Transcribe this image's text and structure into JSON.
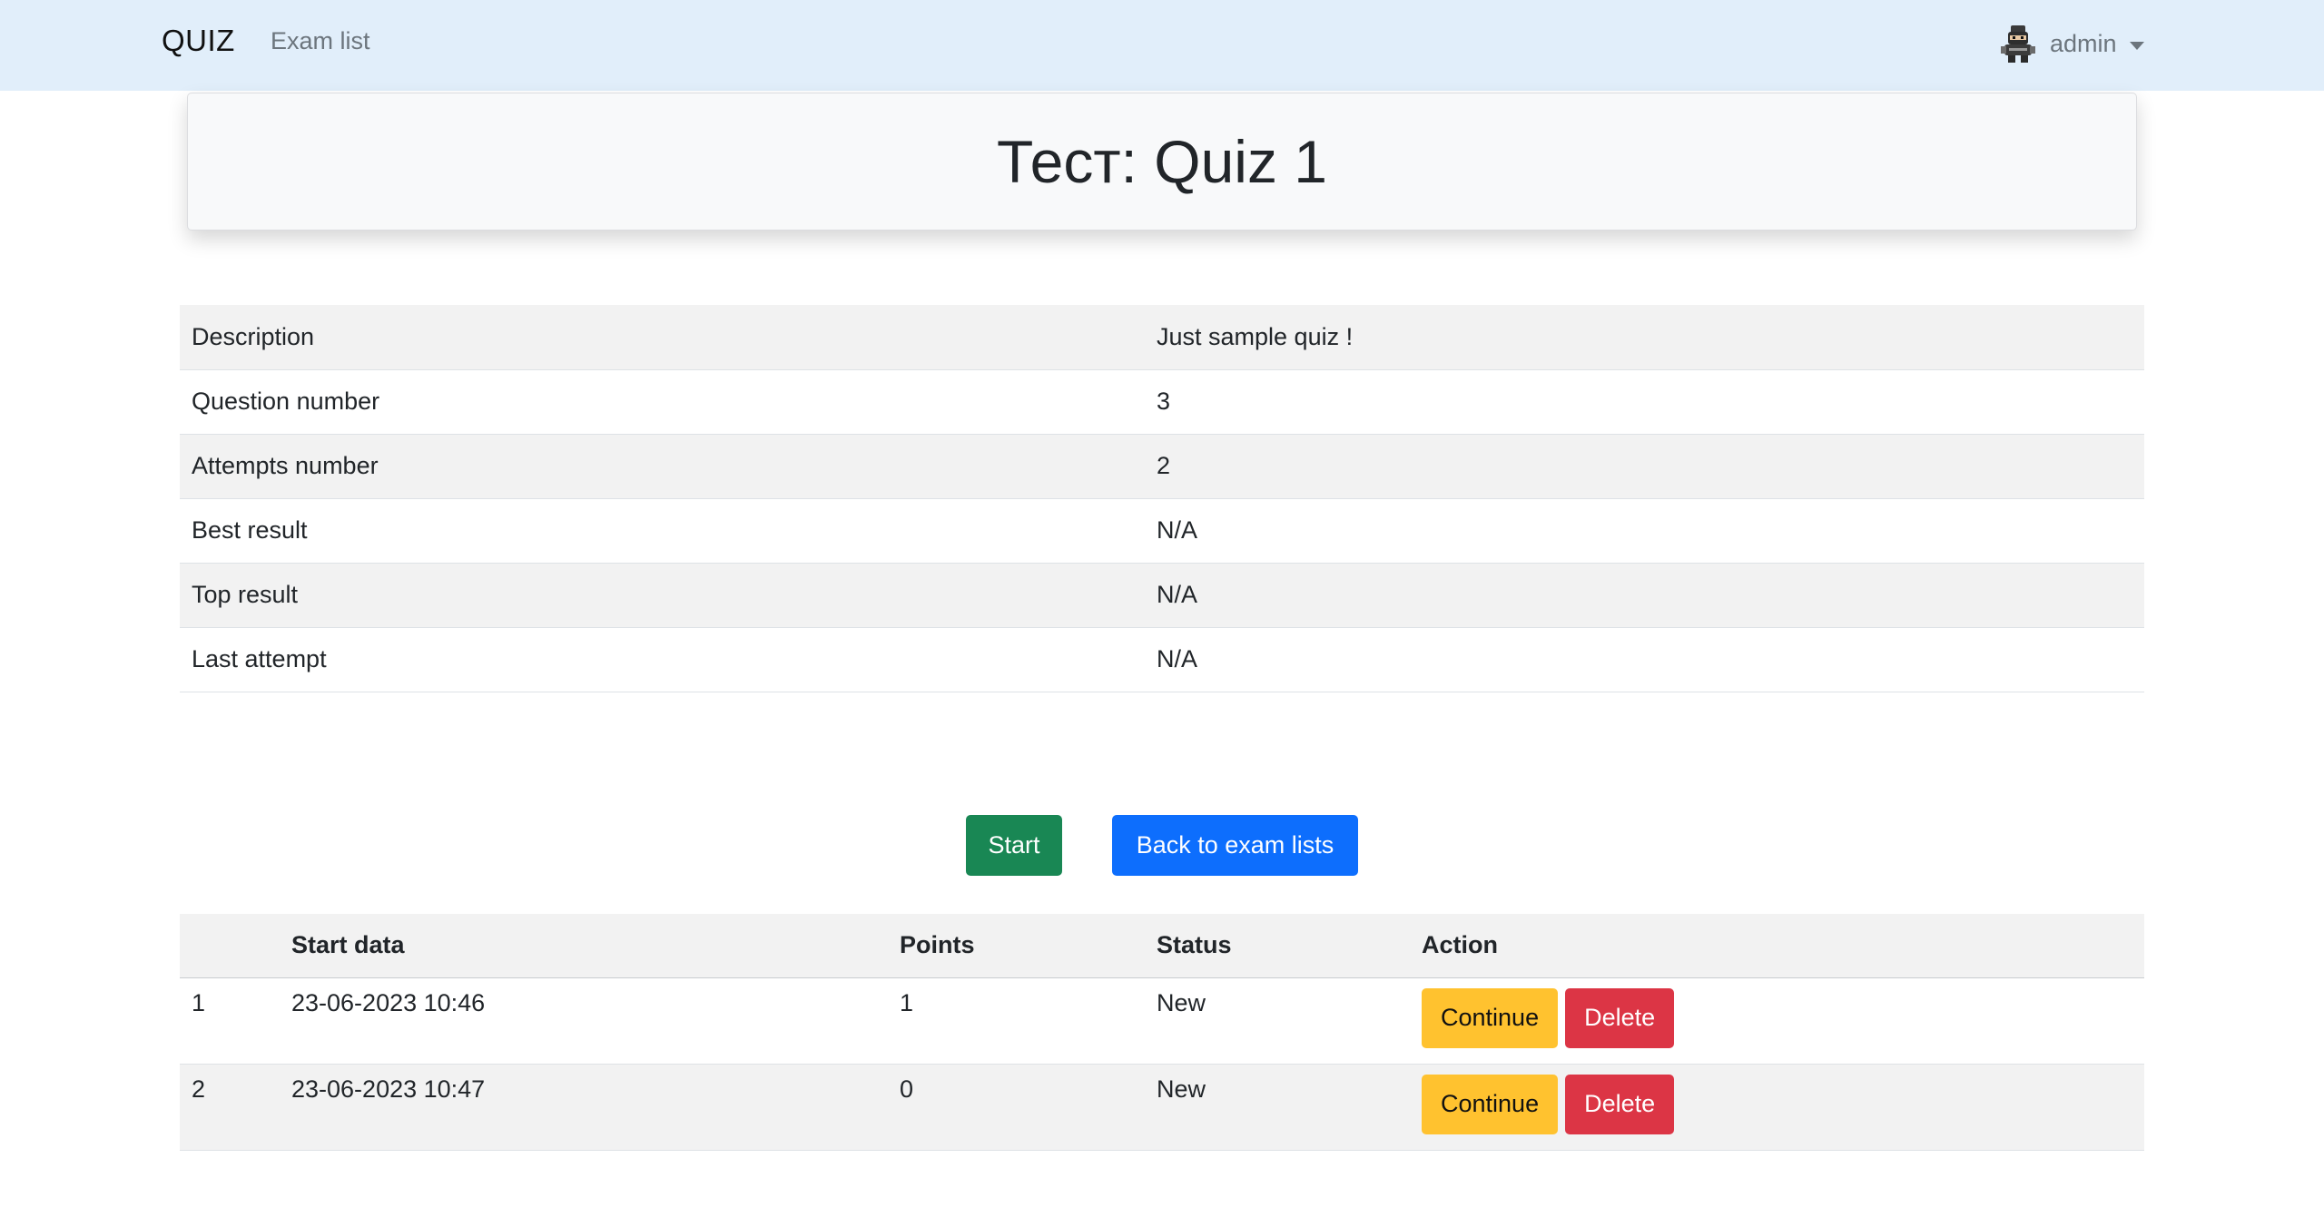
{
  "navbar": {
    "brand": "QUIZ",
    "links": [
      "Exam list"
    ],
    "user": {
      "name": "admin",
      "avatar_icon": "ninja-avatar-icon"
    }
  },
  "title": "Тест: Quiz 1",
  "info": [
    {
      "label": "Description",
      "value": "Just sample quiz !"
    },
    {
      "label": "Question number",
      "value": "3"
    },
    {
      "label": "Attempts number",
      "value": "2"
    },
    {
      "label": "Best result",
      "value": "N/A"
    },
    {
      "label": "Top result",
      "value": "N/A"
    },
    {
      "label": "Last attempt",
      "value": "N/A"
    }
  ],
  "actions": {
    "start": "Start",
    "back": "Back to exam lists"
  },
  "attempts": {
    "headers": [
      "",
      "Start data",
      "Points",
      "Status",
      "Action"
    ],
    "rows": [
      {
        "num": "1",
        "start": "23-06-2023 10:46",
        "points": "1",
        "status": "New"
      },
      {
        "num": "2",
        "start": "23-06-2023 10:47",
        "points": "0",
        "status": "New"
      }
    ],
    "continue_label": "Continue",
    "delete_label": "Delete"
  },
  "colors": {
    "navbar_bg": "#e1eefa",
    "success": "#198754",
    "primary": "#0d6efd",
    "warning": "#ffc22f",
    "danger": "#dc3545"
  }
}
